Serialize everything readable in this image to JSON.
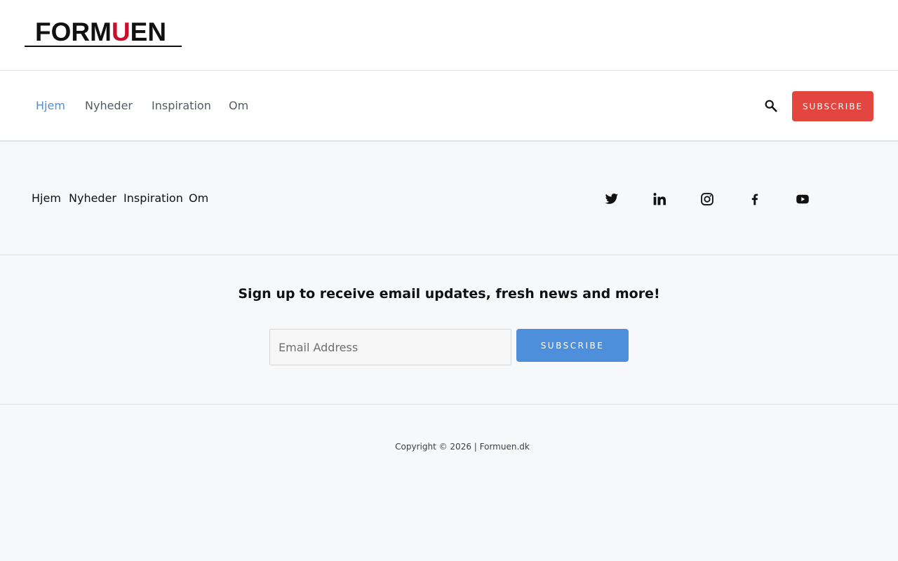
{
  "logo": {
    "text_before": "FORM",
    "text_accent": "U",
    "text_after": "EN"
  },
  "nav": {
    "items": [
      {
        "label": "Hjem",
        "active": true
      },
      {
        "label": "Nyheder",
        "active": false
      },
      {
        "label": "Inspiration",
        "active": false
      },
      {
        "label": "Om",
        "active": false
      }
    ],
    "search_icon": "search-icon",
    "subscribe_label": "SUBSCRIBE"
  },
  "footer_nav": {
    "items": [
      "Hjem",
      "Nyheder",
      "Inspiration",
      "Om"
    ],
    "social_icons": [
      "twitter-icon",
      "linkedin-icon",
      "instagram-icon",
      "facebook-icon",
      "youtube-icon"
    ]
  },
  "signup": {
    "title": "Sign up to receive email updates, fresh news and more!",
    "email_placeholder": "Email Address",
    "subscribe_label": "SUBSCRIBE"
  },
  "copyright": "Copyright © 2026 | Formuen.dk",
  "colors": {
    "accent_blue": "#4d8fdb",
    "accent_red": "#e2463f",
    "logo_red": "#c8102e",
    "background": "#f7f8fa"
  }
}
